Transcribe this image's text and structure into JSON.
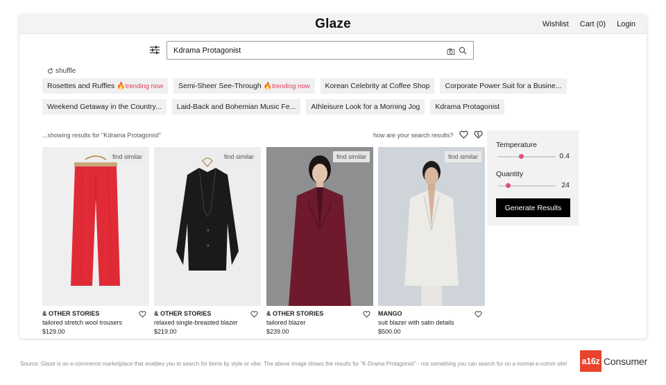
{
  "header": {
    "logo": "Glaze",
    "nav": [
      "Wishlist",
      "Cart (0)",
      "Login"
    ]
  },
  "search": {
    "value": "Kdrama Protagonist",
    "placeholder": ""
  },
  "shuffle_label": "shuffle",
  "chips": [
    {
      "label": "Rosettes and Ruffles",
      "trending": "trending now"
    },
    {
      "label": "Semi-Sheer See-Through",
      "trending": "trending now"
    },
    {
      "label": "Korean Celebrity at Coffee Shop",
      "trending": ""
    },
    {
      "label": "Corporate Power Suit for a Busine...",
      "trending": ""
    },
    {
      "label": "Weekend Getaway in the Country...",
      "trending": ""
    },
    {
      "label": "Laid-Back and Bohemian Music Fe...",
      "trending": ""
    },
    {
      "label": "Athleisure Look for a Morning Jog",
      "trending": ""
    },
    {
      "label": "Kdrama Protagonist",
      "trending": ""
    }
  ],
  "results_label": "...showing results for \"Kdrama Protagonist\"",
  "feedback_label": "how are your search results?",
  "find_similar": "find similar",
  "products": [
    {
      "brand": "& OTHER STORIES",
      "name": "tailored stretch wool trousers",
      "price": "$129.00"
    },
    {
      "brand": "& OTHER STORIES",
      "name": "relaxed single-breasted blazer",
      "price": "$219.00"
    },
    {
      "brand": "& OTHER STORIES",
      "name": "tailored blazer",
      "price": "$239.00"
    },
    {
      "brand": "MANGO",
      "name": "suit blazer with satin details",
      "price": "$500.00"
    }
  ],
  "panel": {
    "temperature_label": "Temperature",
    "temperature_value": "0.4",
    "temperature_fraction": 0.4,
    "quantity_label": "Quantity",
    "quantity_value": "24",
    "quantity_fraction": 0.18,
    "button": "Generate Results"
  },
  "source_note": "Source: Glaze is an e-commerce marketplace that enables you to search for items by style or vibe. The above image shows the results for “K-Drama Protagonist” - not something you can search for on a normal e-comm site!",
  "brand_mark": {
    "box": "a16z",
    "word": "Consumer"
  },
  "colors": {
    "accent": "#e0507a",
    "trending": "#e23a5e",
    "a16z": "#e8432d"
  }
}
